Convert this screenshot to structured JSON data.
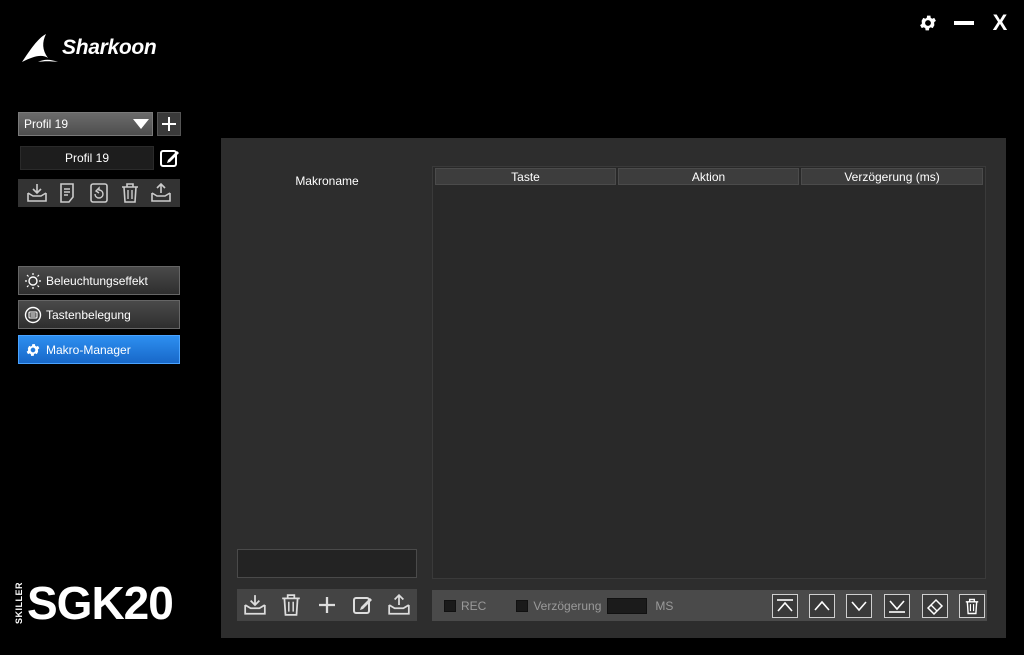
{
  "window": {
    "settings_icon": "gear-icon",
    "minimize_icon": "minimize-icon",
    "close_label": "X"
  },
  "logo": {
    "text": "Sharkoon"
  },
  "profile": {
    "selected": "Profil 19",
    "add_icon": "plus-icon",
    "name": "Profil 19",
    "edit_icon": "edit-icon",
    "tools": [
      "import-icon",
      "notes-icon",
      "reset-icon",
      "trash-icon",
      "export-icon"
    ]
  },
  "nav": {
    "items": [
      {
        "label": "Beleuchtungseffekt",
        "icon": "light-bulb-icon",
        "active": false
      },
      {
        "label": "Tastenbelegung",
        "icon": "keyboard-icon",
        "active": false
      },
      {
        "label": "Makro-Manager",
        "icon": "gear-icon",
        "active": true
      }
    ]
  },
  "brand": {
    "small": "SKILLER",
    "big": "SGK20"
  },
  "macro": {
    "list_title": "Makroname",
    "name_value": "",
    "tools": [
      "import-icon",
      "trash-icon",
      "plus-icon",
      "edit-icon",
      "export-icon"
    ],
    "table": {
      "columns": [
        "Taste",
        "Aktion",
        "Verzögerung (ms)"
      ]
    },
    "record": {
      "rec_label": "REC",
      "delay_label": "Verzögerung",
      "delay_value": "",
      "unit": "MS"
    },
    "order_buttons": [
      "move-top-icon",
      "move-up-icon",
      "move-down-icon",
      "move-bottom-icon",
      "eraser-icon",
      "trash-icon"
    ]
  },
  "colors": {
    "accent": "#1f7ae0",
    "background": "#000000",
    "panel": "#2d2d2d"
  }
}
